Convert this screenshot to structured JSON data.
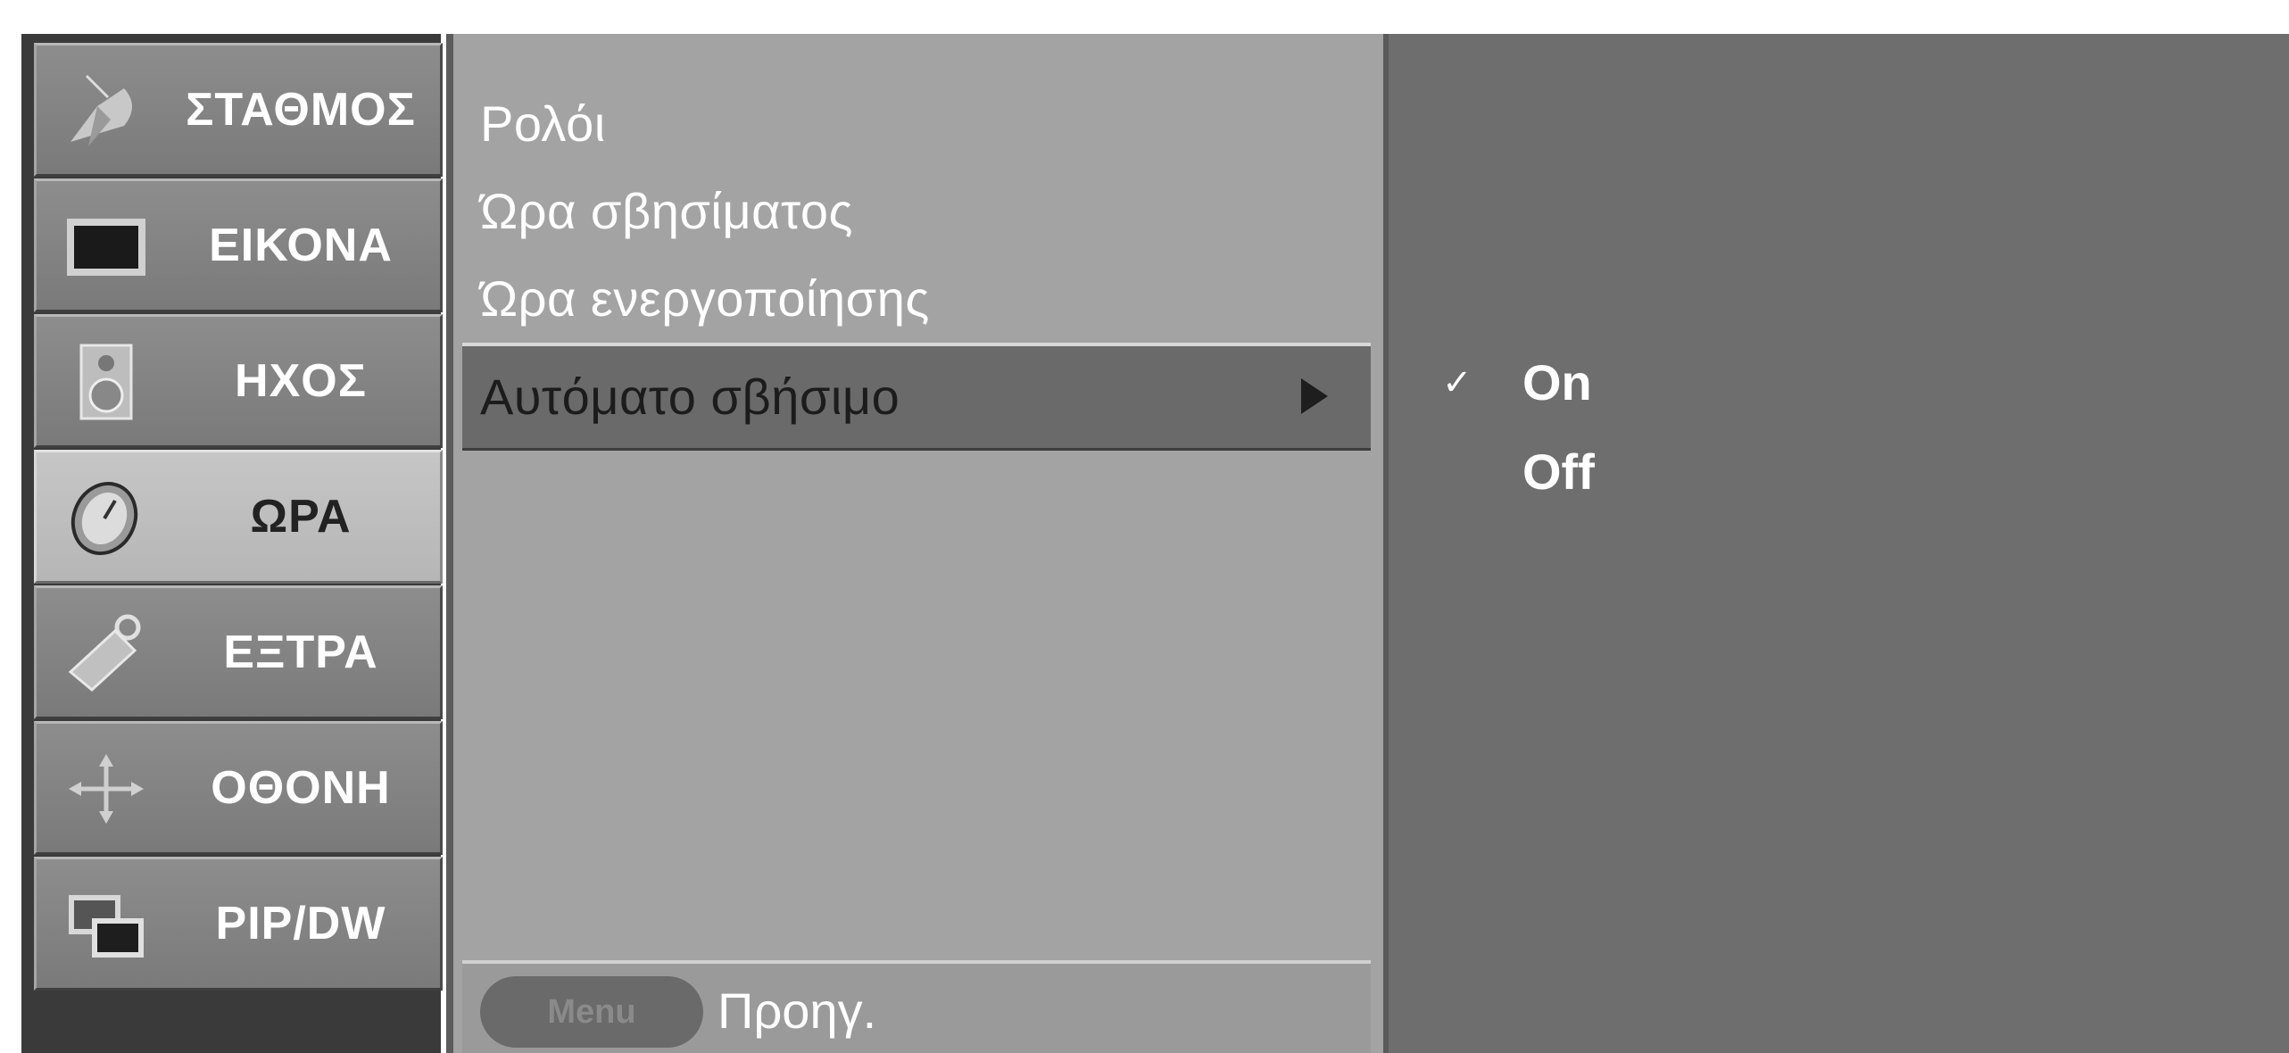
{
  "sidebar": {
    "items": [
      {
        "label": "ΣΤΑΘΜΟΣ",
        "icon": "satellite-dish-icon",
        "selected": false
      },
      {
        "label": "ΕΙΚΟΝΑ",
        "icon": "picture-screen-icon",
        "selected": false
      },
      {
        "label": "ΗΧΟΣ",
        "icon": "speaker-icon",
        "selected": false
      },
      {
        "label": "ΩΡΑ",
        "icon": "clock-icon",
        "selected": true
      },
      {
        "label": "ΕΞΤΡΑ",
        "icon": "tag-key-icon",
        "selected": false
      },
      {
        "label": "ΟΘΟΝΗ",
        "icon": "move-arrows-icon",
        "selected": false
      },
      {
        "label": "PIP/DW",
        "icon": "pip-windows-icon",
        "selected": false
      }
    ]
  },
  "submenu": {
    "items": [
      {
        "label": "Ρολόι"
      },
      {
        "label": "Ώρα σβησίματος"
      },
      {
        "label": "Ώρα ενεργοποίησης"
      },
      {
        "label": "Αυτόματο σβήσιμο",
        "highlighted": true,
        "has_submenu": true
      }
    ],
    "footer": {
      "button_label": "Menu",
      "action_label": "Προηγ."
    }
  },
  "options": {
    "items": [
      {
        "label": "On",
        "checked": true,
        "check_glyph": "✓"
      },
      {
        "label": "Off",
        "checked": false
      }
    ]
  },
  "colors": {
    "sidebar_bg": "#3a3a3a",
    "item_bg": "#858585",
    "item_selected_bg": "#bebebe",
    "submenu_bg": "#a3a3a3",
    "highlight_bg": "#6a6a6a",
    "options_bg": "#6e6e6e"
  }
}
